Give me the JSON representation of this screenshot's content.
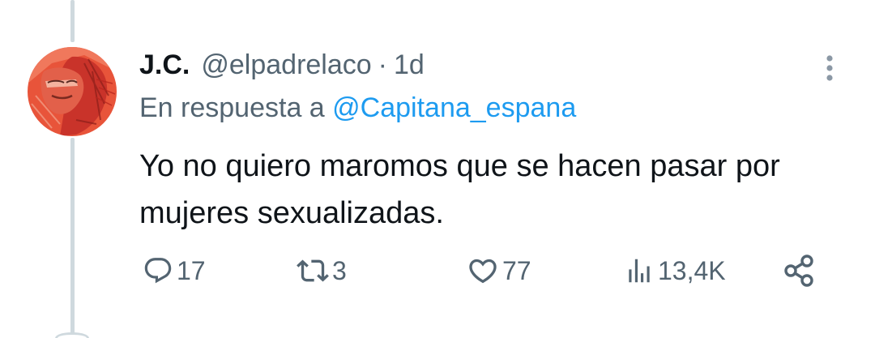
{
  "tweet": {
    "author_name": "J.C.",
    "author_handle": "@elpadrelaco",
    "separator": "·",
    "timestamp": "1d",
    "reply_prefix": "En respuesta a",
    "reply_to": "@Capitana_espana",
    "text": "Yo no quiero maromos que se hacen pasar por mujeres sexualizadas.",
    "replies": "17",
    "retweets": "3",
    "likes": "77",
    "views": "13,4K"
  },
  "icons": {
    "more": "more-vertical-icon",
    "reply": "reply-icon",
    "retweet": "retweet-icon",
    "like": "heart-icon",
    "views": "views-icon",
    "share": "share-icon"
  },
  "colors": {
    "text": "#0f1419",
    "secondary": "#536471",
    "link": "#1d9bf0",
    "thread_line": "#cfd9de",
    "avatar_primary": "#e5553b"
  }
}
